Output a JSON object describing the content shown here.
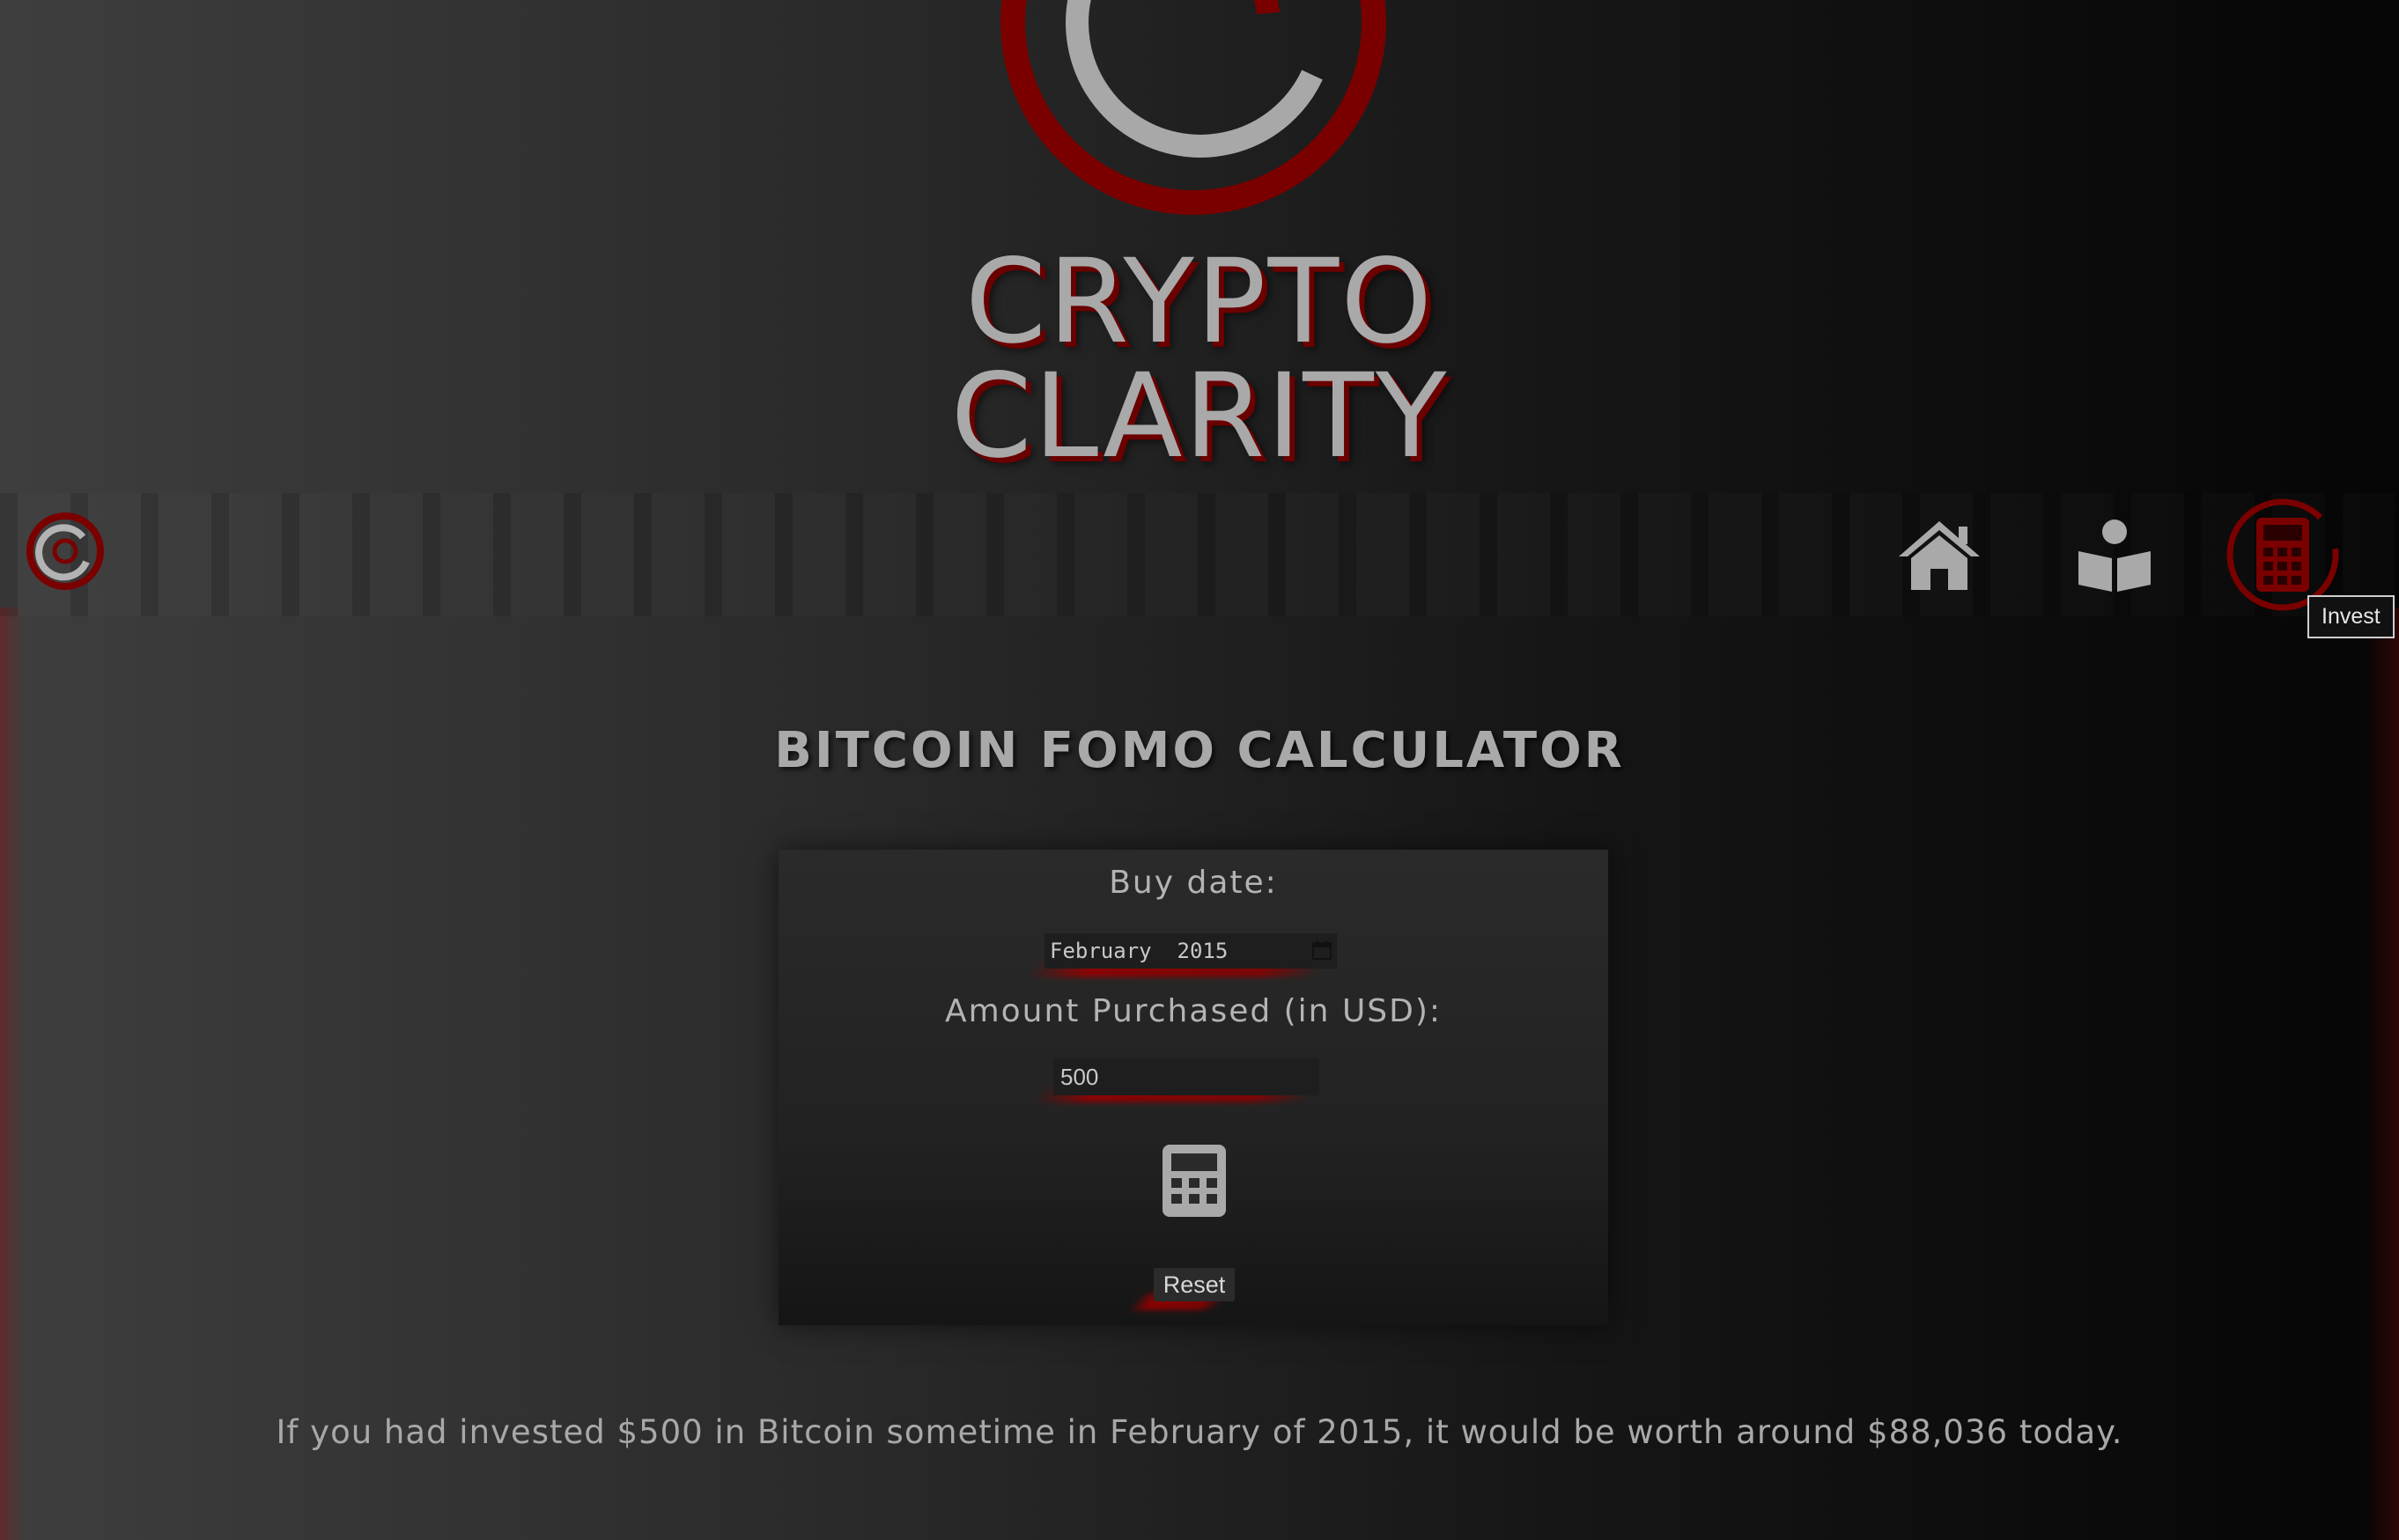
{
  "brand": {
    "line1": "CRYPTO",
    "line2": "CLARITY"
  },
  "nav": {
    "items": [
      {
        "name": "home",
        "icon": "home-icon"
      },
      {
        "name": "learn",
        "icon": "book-reader-icon"
      },
      {
        "name": "invest",
        "icon": "calculator-icon",
        "active": true
      }
    ],
    "tooltip": "Invest"
  },
  "calculator": {
    "title": "BITCOIN FOMO CALCULATOR",
    "buy_date_label": "Buy date:",
    "buy_date_value": "February  2015",
    "amount_label": "Amount Purchased (in USD):",
    "amount_value": "500",
    "calculate_icon": "calculator-icon",
    "reset_label": "Reset"
  },
  "result_text": "If you had invested $500 in Bitcoin sometime in February of 2015, it would be worth around $88,036 today.",
  "colors": {
    "accent": "#7a0000",
    "text": "#a9a9a9"
  }
}
